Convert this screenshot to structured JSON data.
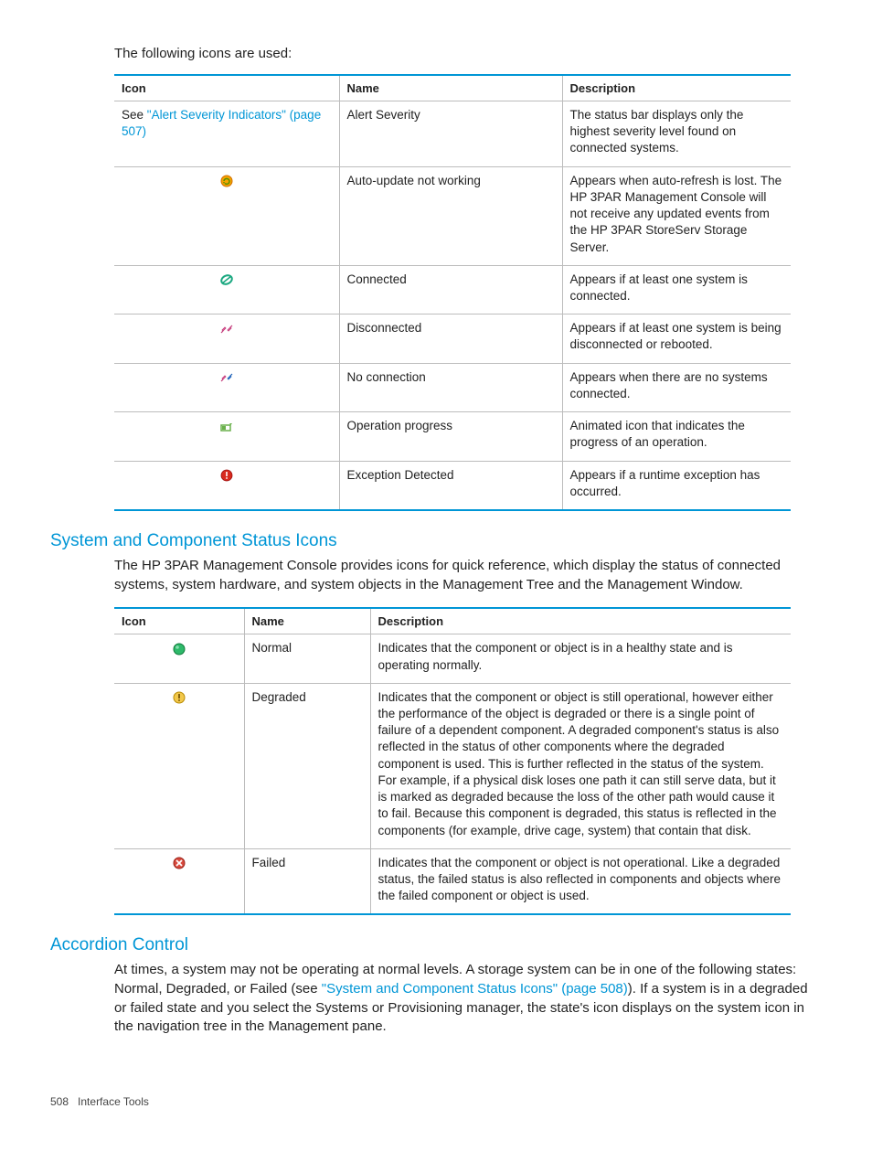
{
  "intro": "The following icons are used:",
  "table1": {
    "headers": [
      "Icon",
      "Name",
      "Description"
    ],
    "rows": [
      {
        "icon_text_prefix": "See ",
        "icon_link": "\"Alert Severity Indicators\" (page 507)",
        "name": "Alert Severity",
        "desc": "The status bar displays only the highest severity level found on connected systems."
      },
      {
        "icon_key": "auto-update",
        "name": "Auto-update not working",
        "desc": "Appears when auto-refresh is lost. The HP 3PAR Management Console will not receive any updated events from the HP 3PAR StoreServ Storage Server."
      },
      {
        "icon_key": "connected",
        "name": "Connected",
        "desc": "Appears if at least one system is connected."
      },
      {
        "icon_key": "disconnected",
        "name": "Disconnected",
        "desc": "Appears if at least one system is being disconnected or rebooted."
      },
      {
        "icon_key": "no-connection",
        "name": "No connection",
        "desc": "Appears when there are no systems connected."
      },
      {
        "icon_key": "progress",
        "name": "Operation progress",
        "desc": "Animated icon that indicates the progress of an operation."
      },
      {
        "icon_key": "exception",
        "name": "Exception Detected",
        "desc": "Appears if a runtime exception has occurred."
      }
    ]
  },
  "section1_head": "System and Component Status Icons",
  "section1_body": "The HP 3PAR Management Console provides icons for quick reference, which display the status of connected systems, system hardware, and system objects in the Management Tree and the Management Window.",
  "table2": {
    "headers": [
      "Icon",
      "Name",
      "Description"
    ],
    "rows": [
      {
        "icon_key": "normal",
        "name": "Normal",
        "desc": "Indicates that the component or object is in a healthy state and is operating normally."
      },
      {
        "icon_key": "degraded",
        "name": "Degraded",
        "desc": "Indicates that the component or object is still operational, however either the performance of the object is degraded or there is a single point of failure of a dependent component. A degraded component's status is also reflected in the status of other components where the degraded component is used. This is further reflected in the status of the system. For example, if a physical disk loses one path it can still serve data, but it is marked as degraded because the loss of the other path would cause it to fail. Because this component is degraded, this status is reflected in the components (for example, drive cage, system) that contain that disk."
      },
      {
        "icon_key": "failed",
        "name": "Failed",
        "desc": "Indicates that the component or object is not operational. Like a degraded status, the failed status is also reflected in components and objects where the failed component or object is used."
      }
    ]
  },
  "section2_head": "Accordion Control",
  "section2_body_pre": "At times, a system may not be operating at normal levels. A storage system can be in one of the following states: Normal, Degraded, or Failed (see ",
  "section2_link": "\"System and Component Status Icons\" (page 508)",
  "section2_body_post": "). If a system is in a degraded or failed state and you select the Systems or Provisioning manager, the state's icon displays on the system icon in the navigation tree in the Management pane.",
  "footer_page": "508",
  "footer_title": "Interface Tools"
}
